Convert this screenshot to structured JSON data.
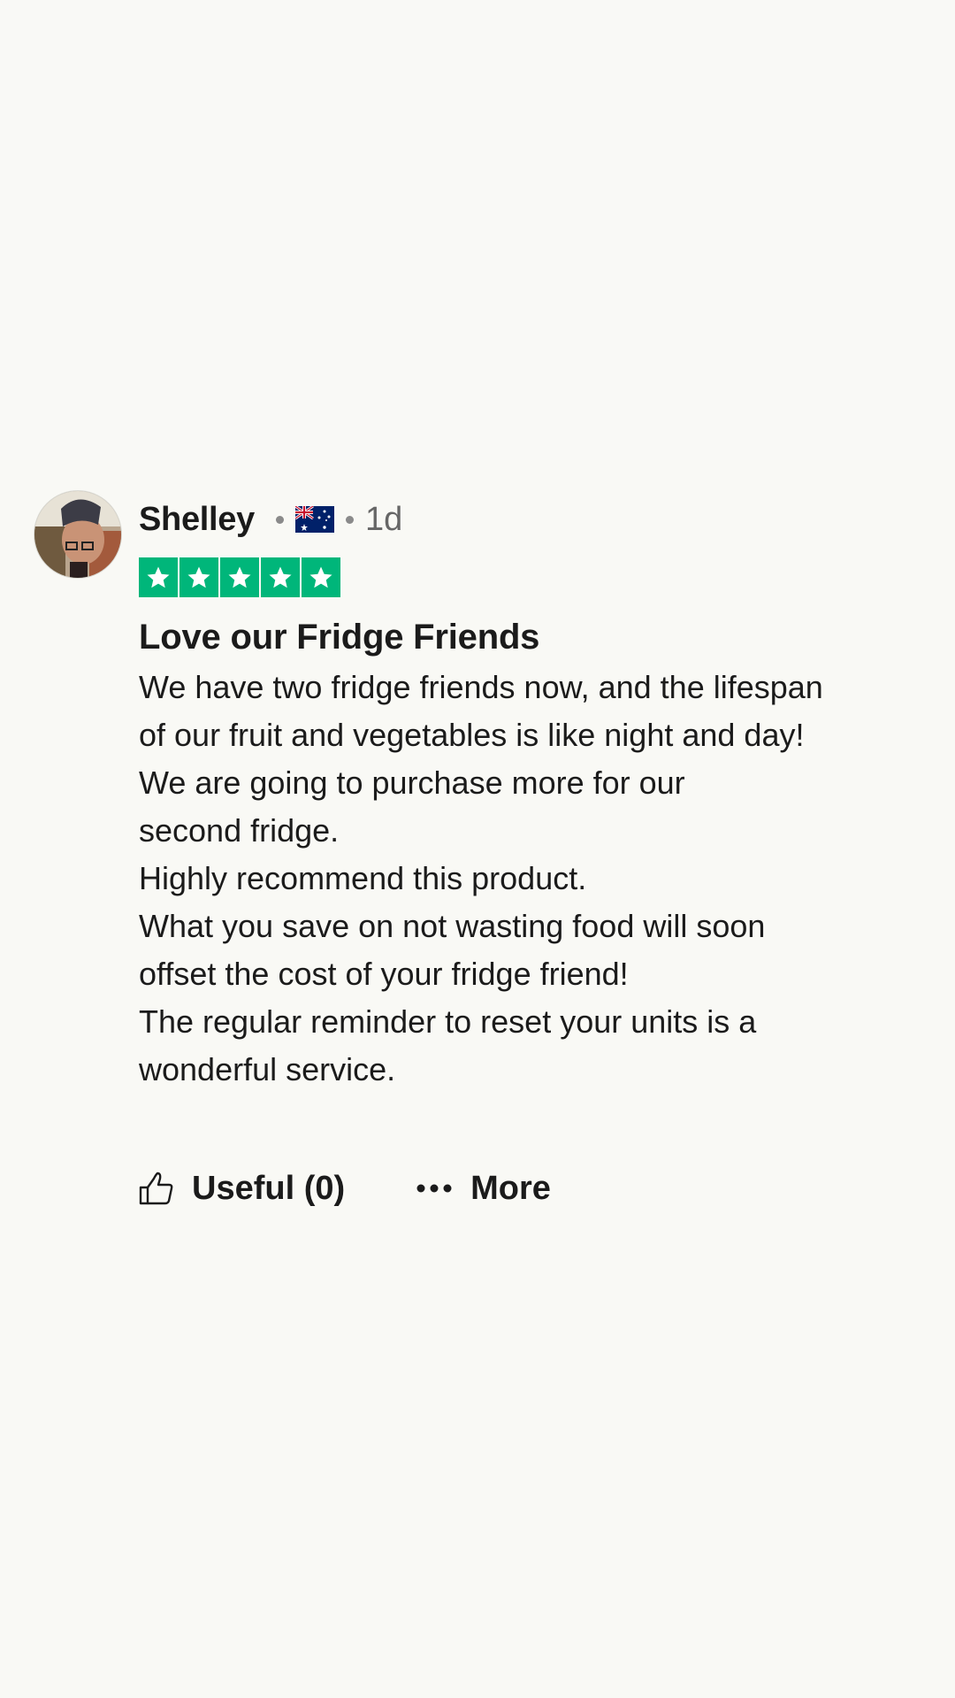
{
  "review": {
    "reviewer_name": "Shelley",
    "country_flag_icon": "australia-flag-icon",
    "age": "1d",
    "rating": 5,
    "rating_max": 5,
    "star_color": "#00b67a",
    "title": "Love our Fridge Friends",
    "body_lines": [
      "We have two fridge friends now, and the lifespan",
      "of our fruit and vegetables is like night and day!",
      "We are going to purchase more for our",
      "second fridge.",
      "Highly recommend this product.",
      "What you save on not wasting food will soon",
      "offset the cost of your fridge friend!",
      "The regular reminder to reset your units is a",
      "wonderful service."
    ]
  },
  "actions": {
    "useful_label": "Useful (0)",
    "useful_icon": "thumbs-up-icon",
    "more_label": "More",
    "more_icon": "ellipsis-icon"
  }
}
